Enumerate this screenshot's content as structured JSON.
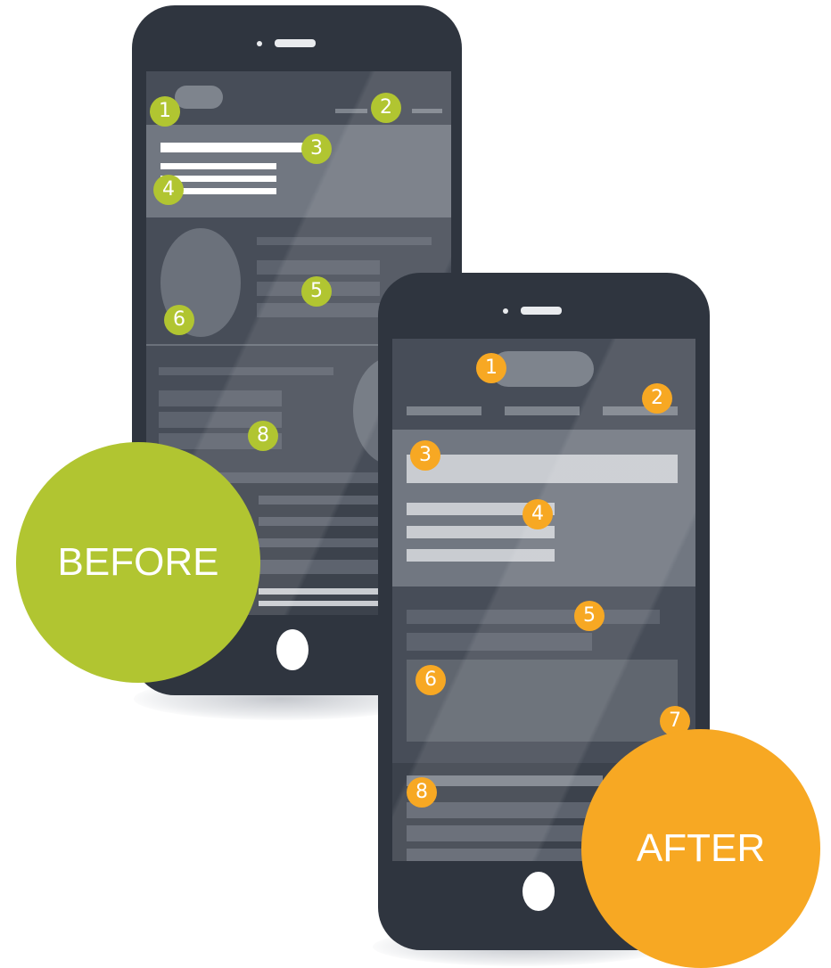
{
  "before": {
    "label": "BEFORE",
    "color": "#b1c531",
    "badges": [
      "1",
      "2",
      "3",
      "4",
      "5",
      "6",
      "8"
    ]
  },
  "after": {
    "label": "AFTER",
    "color": "#f7a823",
    "badges": [
      "1",
      "2",
      "3",
      "4",
      "5",
      "6",
      "7",
      "8"
    ]
  },
  "icons": [
    "speaker-icon",
    "camera-icon",
    "home-button-icon"
  ]
}
